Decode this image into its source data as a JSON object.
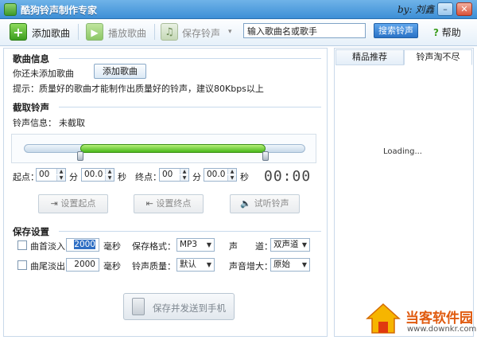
{
  "window": {
    "title": "酷狗铃声制作专家",
    "signature": "by: 刘鑫"
  },
  "toolbar": {
    "add_song": "添加歌曲",
    "play_song": "播放歌曲",
    "save_ringtone": "保存铃声",
    "search_value": "输入歌曲名或歌手",
    "search_button": "搜索铃声",
    "help": "帮助"
  },
  "song_info": {
    "title": "歌曲信息",
    "status": "你还未添加歌曲",
    "add_button": "添加歌曲",
    "tip": "提示：质量好的歌曲才能制作出质量好的铃声，建议80Kbps以上"
  },
  "cut": {
    "title": "截取铃声",
    "info_label": "铃声信息：",
    "info_value": "未截取",
    "range_start_fraction": 0.2,
    "range_end_fraction": 0.86,
    "start_label": "起点：",
    "end_label": "终点：",
    "min_unit": "分",
    "sec_unit": "秒",
    "start_min": "00",
    "start_sec": "00.0",
    "end_min": "00",
    "end_sec": "00.0",
    "timer": "00:00",
    "set_start": "设置起点",
    "set_end": "设置终点",
    "preview": "试听铃声"
  },
  "save": {
    "title": "保存设置",
    "fade_in_label": "曲首淡入",
    "fade_in_value": "2000",
    "fade_out_label": "曲尾淡出",
    "fade_out_value": "2000",
    "ms_unit": "毫秒",
    "format_label": "保存格式：",
    "format_value": "MP3",
    "channel_label": "声　　道：",
    "channel_value": "双声道",
    "quality_label": "铃声质量：",
    "quality_value": "默认",
    "volume_label": "声音增大：",
    "volume_value": "原始",
    "send_button": "保存并发送到手机"
  },
  "right_panel": {
    "tab1": "精品推荐",
    "tab2": "铃声淘不尽",
    "loading": "Loading..."
  },
  "watermark": {
    "name": "当客软件园",
    "url": "www.downkr.com"
  },
  "colors": {
    "accent": "#3d8fd6",
    "slider_fill": "#48b81a",
    "watermark": "#e05a0f"
  }
}
